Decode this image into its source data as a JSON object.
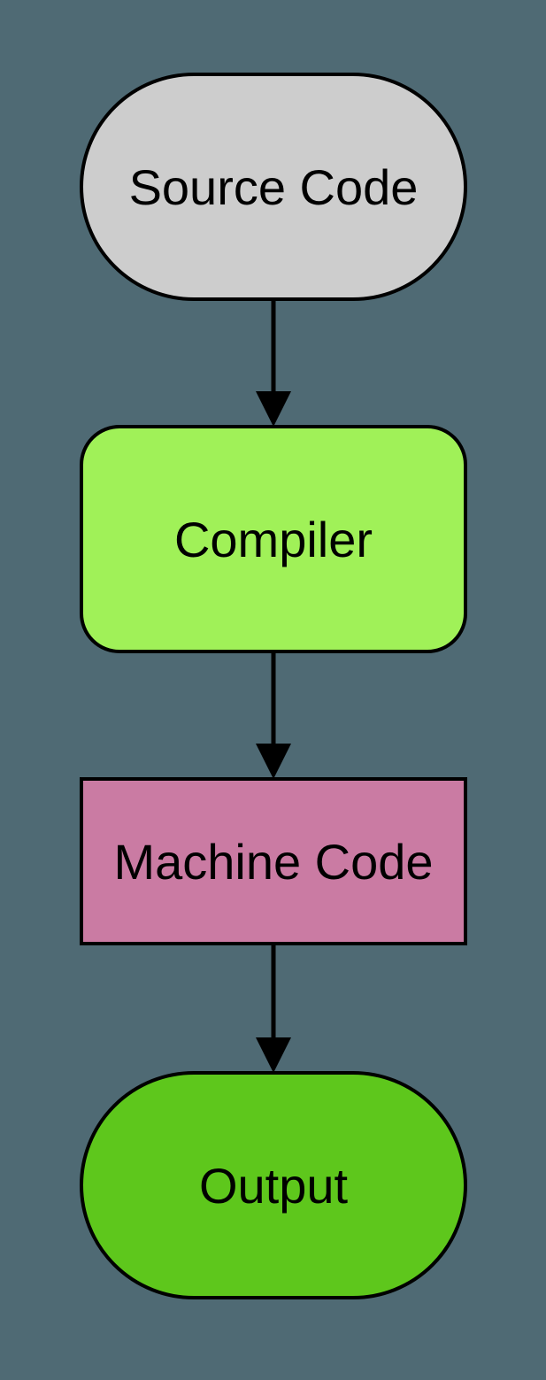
{
  "diagram": {
    "nodes": {
      "source": {
        "label": "Source Code",
        "shape": "stadium",
        "fill": "#cdcdcd"
      },
      "compiler": {
        "label": "Compiler",
        "shape": "rounded-rect",
        "fill": "#a0f158"
      },
      "machine": {
        "label": "Machine Code",
        "shape": "rect",
        "fill": "#ca7ba3"
      },
      "output": {
        "label": "Output",
        "shape": "stadium",
        "fill": "#5ec71c"
      }
    },
    "edges": [
      {
        "from": "source",
        "to": "compiler"
      },
      {
        "from": "compiler",
        "to": "machine"
      },
      {
        "from": "machine",
        "to": "output"
      }
    ]
  }
}
